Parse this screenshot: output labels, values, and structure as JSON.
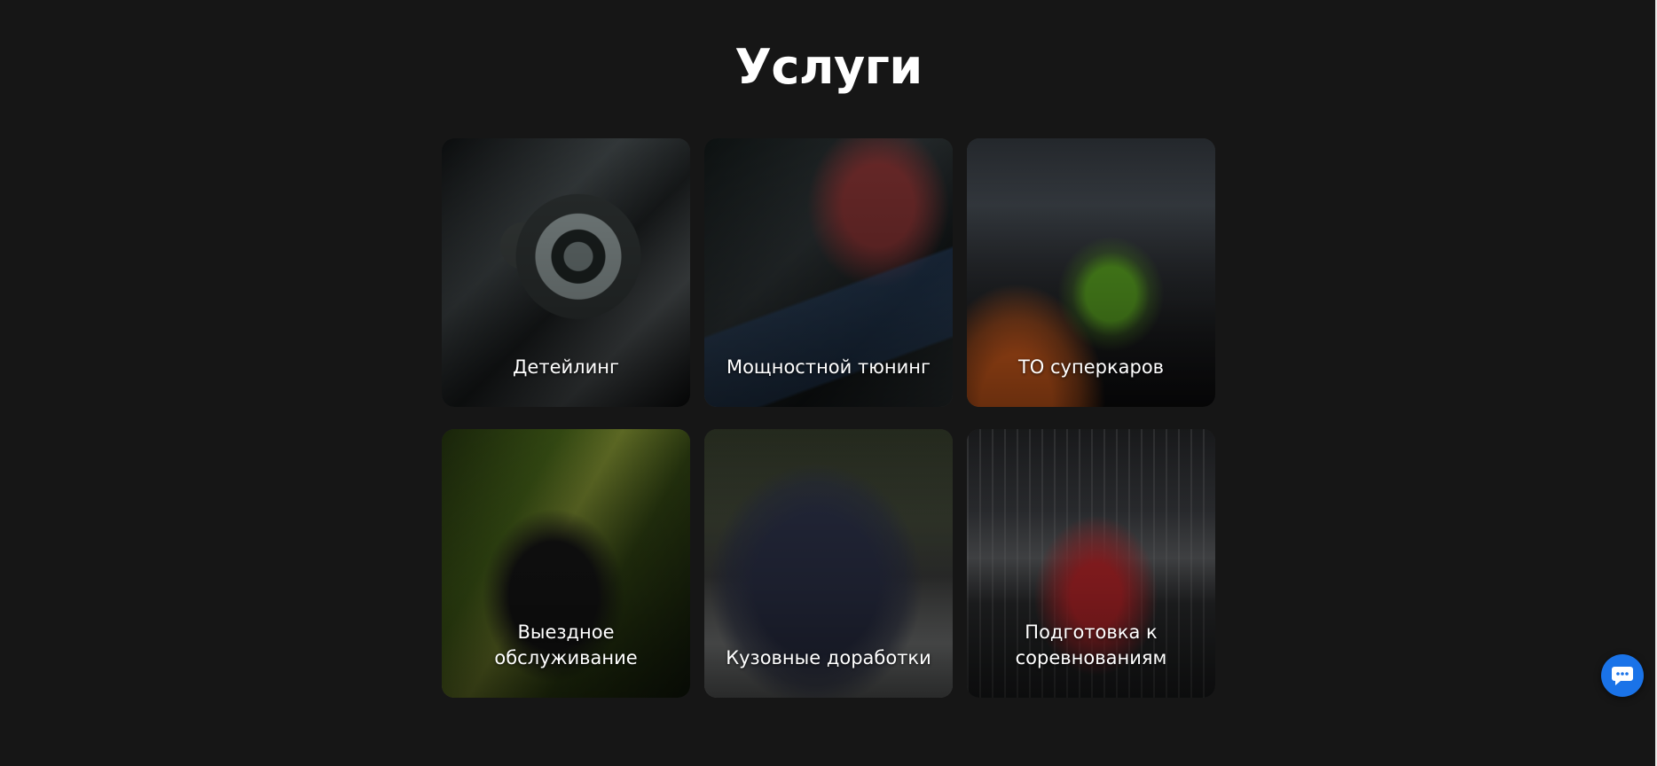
{
  "page": {
    "title": "Услуги"
  },
  "services": [
    {
      "label": "Детейлинг",
      "image": "car-detailing-polishing-photo"
    },
    {
      "label": "Мощностной тюнинг",
      "image": "laptop-ecu-tuning-photo"
    },
    {
      "label": "ТО суперкаров",
      "image": "supercar-garage-photo"
    },
    {
      "label": "Выездное обслуживание",
      "image": "suv-in-forest-photo"
    },
    {
      "label": "Кузовные доработки",
      "image": "classic-porsche-photo"
    },
    {
      "label": "Подготовка к соревнованиям",
      "image": "race-car-track-photo"
    }
  ],
  "chat": {
    "icon": "chat-bubble-icon",
    "color": "#1a73e8"
  },
  "colors": {
    "background": "#161616",
    "text": "#ffffff"
  }
}
